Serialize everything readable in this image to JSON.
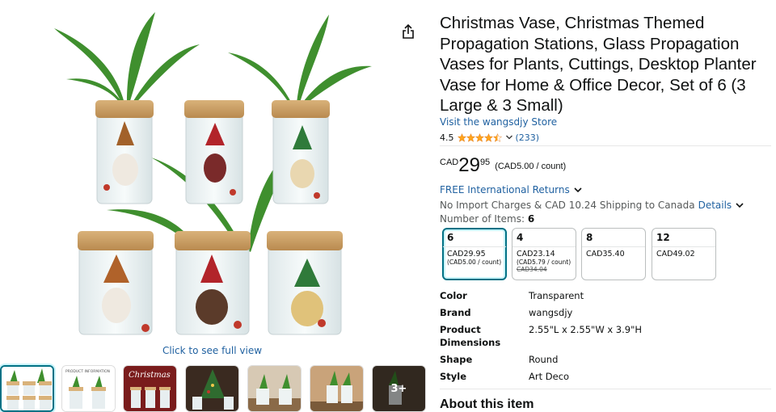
{
  "product": {
    "title": "Christmas Vase, Christmas Themed Propagation Stations, Glass Propagation Vases for Plants, Cuttings, Desktop Planter Vase for Home & Office Decor, Set of 6 (3 Large & 3 Small)",
    "store_link": "Visit the wangsdjy Store",
    "rating": "4.5",
    "rating_count": "(233)",
    "price": {
      "currency": "CAD",
      "whole": "29",
      "fraction": "95",
      "unit": "(CAD5.00 / count)"
    },
    "returns": "FREE International Returns",
    "shipping": "No Import Charges & CAD 10.24 Shipping to Canada",
    "shipping_details": "Details",
    "number_of_items_label": "Number of Items:",
    "number_of_items_value": "6"
  },
  "options": [
    {
      "label": "6",
      "price": "CAD29.95",
      "sub": "(CAD5.00 / count)",
      "strike": ""
    },
    {
      "label": "4",
      "price": "CAD23.14",
      "sub": "(CAD5.79 / count)",
      "strike": "CAD34.04"
    },
    {
      "label": "8",
      "price": "CAD35.40",
      "sub": "",
      "strike": ""
    },
    {
      "label": "12",
      "price": "CAD49.02",
      "sub": "",
      "strike": ""
    }
  ],
  "specs": [
    {
      "key": "Color",
      "value": "Transparent"
    },
    {
      "key": "Brand",
      "value": "wangsdjy"
    },
    {
      "key": "Product Dimensions",
      "value": "2.55\"L x 2.55\"W x 3.9\"H"
    },
    {
      "key": "Shape",
      "value": "Round"
    },
    {
      "key": "Style",
      "value": "Art Deco"
    }
  ],
  "gallery": {
    "full_view": "Click to see full view",
    "more_label": "3+",
    "thumb_2_text": "PRODUCT INFORMATION",
    "thumb_3_text": "Christmas"
  },
  "about_heading": "About this item",
  "colors": {
    "link": "#2162a1",
    "selected_border": "#007185",
    "star": "#ffa41c"
  }
}
